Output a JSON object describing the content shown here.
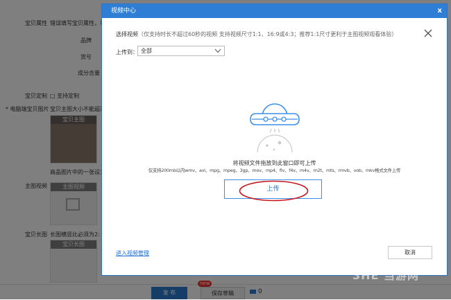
{
  "background": {
    "labels": [
      "宝贝属性",
      "错误填写宝贝属性，可能",
      "品牌",
      "货号",
      "成分含量",
      "宝贝定制",
      "支持定制",
      "* 电脑端宝贝图片",
      "宝贝主图大小不能超过",
      "商品图片中的一张设为",
      "主图视频",
      "宝贝长图",
      "长图横竖比必须为2:"
    ],
    "thumb_captions": [
      "宝贝主图",
      "主图视频",
      "宝贝长图"
    ]
  },
  "footer": {
    "publish_label": "发 布",
    "draft_label": "保存草稿",
    "new_badge": "new",
    "message_count": "0"
  },
  "modal": {
    "title": "视频中心",
    "close_label": "x",
    "section_title": "选择视频",
    "section_note": "（仅支持时长不超过60秒的视频 支持视频尺寸1:1、16:9或4:3；推荐1:1尺寸更利于主图视频观看体验）",
    "upload_to_label": "上传到：",
    "upload_to_value": "全部",
    "drag_hint": "将视频文件拖放到此窗口即可上传",
    "formats_hint": "仅支持200mb以内wmv、avi、mpg、mpeg、3gp、mov、mp4、flv、f4v、m4v、m2t、mts、rmvb、vob、mkv格式文件上传",
    "upload_button": "上传",
    "manage_link": "进入视频管理",
    "cancel_button": "取消"
  },
  "colors": {
    "header_blue": "#2d7ed4",
    "accent_blue": "#3a8ee6",
    "highlight_red": "#c8151c"
  },
  "watermark": "3HE 当游网"
}
